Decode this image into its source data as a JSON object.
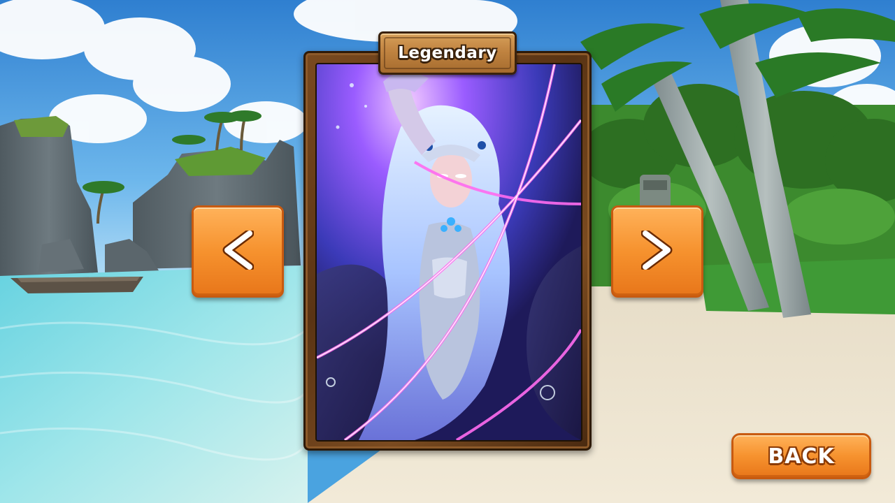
{
  "card": {
    "rarity_label": "Legendary"
  },
  "navigation": {
    "prev_icon": "chevron-left-icon",
    "next_icon": "chevron-right-icon"
  },
  "back_button": {
    "label": "BACK"
  },
  "colors": {
    "button_orange": "#f6922e",
    "button_border": "#c85a10",
    "frame_wood": "#6a3d18",
    "plaque_wood": "#c08340"
  }
}
